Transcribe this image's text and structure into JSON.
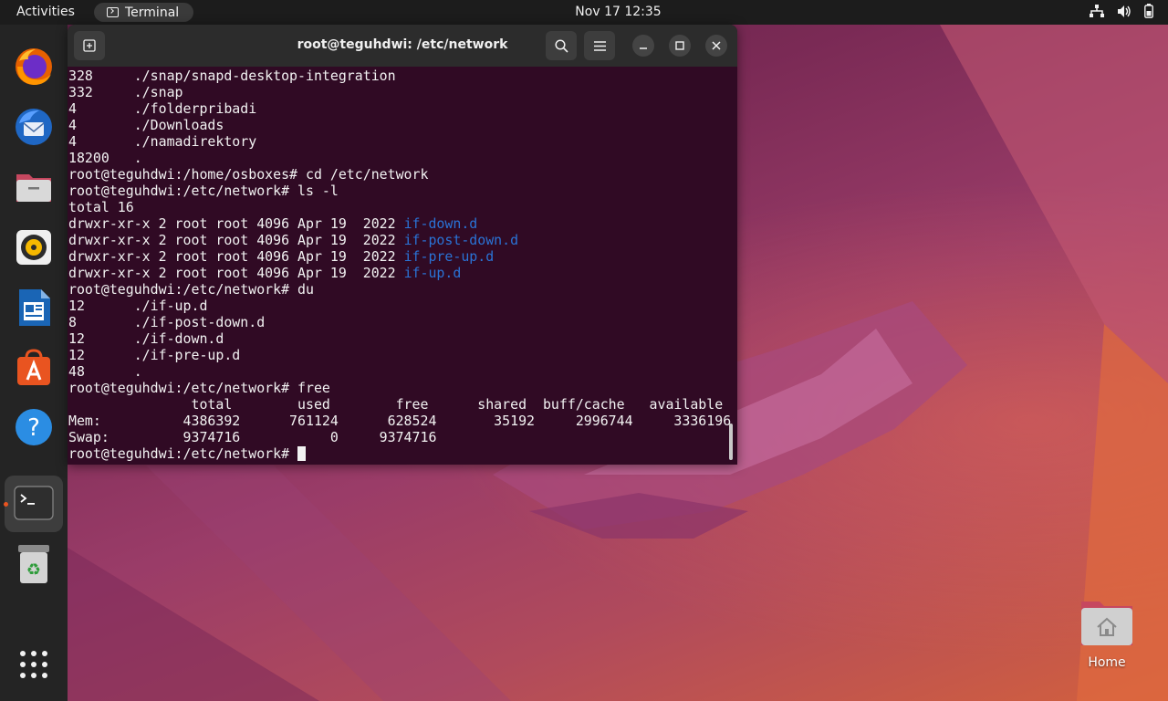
{
  "topbar": {
    "activities": "Activities",
    "app_name": "Terminal",
    "clock": "Nov 17  12:35"
  },
  "terminal": {
    "title": "root@teguhdwi: /etc/network",
    "lines": [
      {
        "text": "328     ./snap/snapd-desktop-integration"
      },
      {
        "text": "332     ./snap"
      },
      {
        "text": "4       ./folderpribadi"
      },
      {
        "text": "4       ./Downloads"
      },
      {
        "text": "4       ./namadirektory"
      },
      {
        "text": "18200   ."
      },
      {
        "text": "root@teguhdwi:/home/osboxes# cd /etc/network"
      },
      {
        "text": "root@teguhdwi:/etc/network# ls -l"
      },
      {
        "text": "total 16"
      },
      {
        "text": "drwxr-xr-x 2 root root 4096 Apr 19  2022 ",
        "dir": "if-down.d"
      },
      {
        "text": "drwxr-xr-x 2 root root 4096 Apr 19  2022 ",
        "dir": "if-post-down.d"
      },
      {
        "text": "drwxr-xr-x 2 root root 4096 Apr 19  2022 ",
        "dir": "if-pre-up.d"
      },
      {
        "text": "drwxr-xr-x 2 root root 4096 Apr 19  2022 ",
        "dir": "if-up.d"
      },
      {
        "text": "root@teguhdwi:/etc/network# du"
      },
      {
        "text": "12      ./if-up.d"
      },
      {
        "text": "8       ./if-post-down.d"
      },
      {
        "text": "12      ./if-down.d"
      },
      {
        "text": "12      ./if-pre-up.d"
      },
      {
        "text": "48      ."
      },
      {
        "text": "root@teguhdwi:/etc/network# free"
      },
      {
        "text": "               total        used        free      shared  buff/cache   available"
      },
      {
        "text": "Mem:          4386392      761124      628524       35192     2996744     3336196"
      },
      {
        "text": "Swap:         9374716           0     9374716"
      }
    ],
    "prompt": "root@teguhdwi:/etc/network# "
  },
  "desktop": {
    "home_label": "Home"
  },
  "colors": {
    "terminal_bg": "#300a24",
    "directory": "#2a73d6",
    "accent": "#e95420"
  }
}
